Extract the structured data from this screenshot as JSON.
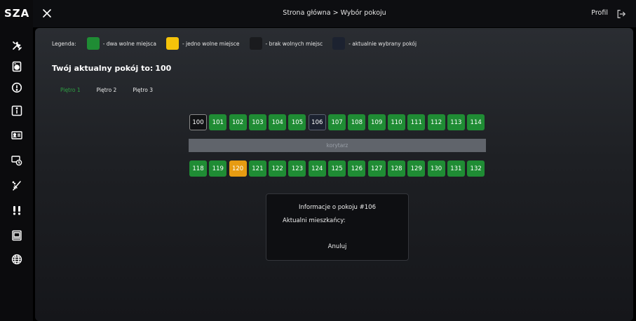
{
  "app": {
    "logo": "SZA"
  },
  "topbar": {
    "breadcrumb": "Strona główna > Wybór pokoju",
    "profile_label": "Profil"
  },
  "sidebar": {
    "items": [
      {
        "icon": "tools-icon"
      },
      {
        "icon": "washer-icon"
      },
      {
        "icon": "alert-icon"
      },
      {
        "icon": "info-icon"
      },
      {
        "icon": "id-card-icon"
      },
      {
        "icon": "payment-icon"
      },
      {
        "icon": "cleaning-icon"
      },
      {
        "icon": "report-icon"
      },
      {
        "icon": "monitor-icon"
      },
      {
        "icon": "globe-icon"
      }
    ]
  },
  "legend": {
    "label": "Legenda:",
    "items": [
      {
        "text": "- dwa wolne miejsca",
        "color": "#1f8c34"
      },
      {
        "text": "- jedno wolne miejsce",
        "color": "#f5c30a"
      },
      {
        "text": "- brak wolnych miejsc",
        "color": "#1a1b1e"
      },
      {
        "text": "- aktualnie wybrany pokój",
        "color": "#1c2230"
      }
    ]
  },
  "current_room": {
    "label": "Twój aktualny pokój to:",
    "value": "100"
  },
  "floors": {
    "tabs": [
      "Piętro 1",
      "Piętro 2",
      "Piętro 3"
    ],
    "active": "Piętro 1"
  },
  "rooms": {
    "row1": [
      {
        "number": "100",
        "status": "full"
      },
      {
        "number": "101",
        "status": "free2"
      },
      {
        "number": "102",
        "status": "free2"
      },
      {
        "number": "103",
        "status": "free2"
      },
      {
        "number": "104",
        "status": "free2"
      },
      {
        "number": "105",
        "status": "free2"
      },
      {
        "number": "106",
        "status": "selected"
      },
      {
        "number": "107",
        "status": "free2"
      },
      {
        "number": "108",
        "status": "free2"
      },
      {
        "number": "109",
        "status": "free2"
      },
      {
        "number": "110",
        "status": "free2"
      },
      {
        "number": "111",
        "status": "free2"
      },
      {
        "number": "112",
        "status": "free2"
      },
      {
        "number": "113",
        "status": "free2"
      },
      {
        "number": "114",
        "status": "free2"
      }
    ],
    "corridor_label": "korytarz",
    "row2": [
      {
        "number": "118",
        "status": "free2"
      },
      {
        "number": "119",
        "status": "free2"
      },
      {
        "number": "120",
        "status": "free1"
      },
      {
        "number": "121",
        "status": "free2"
      },
      {
        "number": "122",
        "status": "free2"
      },
      {
        "number": "123",
        "status": "free2"
      },
      {
        "number": "124",
        "status": "free2"
      },
      {
        "number": "125",
        "status": "free2"
      },
      {
        "number": "126",
        "status": "free2"
      },
      {
        "number": "127",
        "status": "free2"
      },
      {
        "number": "128",
        "status": "free2"
      },
      {
        "number": "129",
        "status": "free2"
      },
      {
        "number": "130",
        "status": "free2"
      },
      {
        "number": "131",
        "status": "free2"
      },
      {
        "number": "132",
        "status": "free2"
      }
    ]
  },
  "info_panel": {
    "title": "Informacje o pokoju #106",
    "residents_label": "Aktualni mieszkańcy:",
    "cancel_label": "Anuluj"
  }
}
